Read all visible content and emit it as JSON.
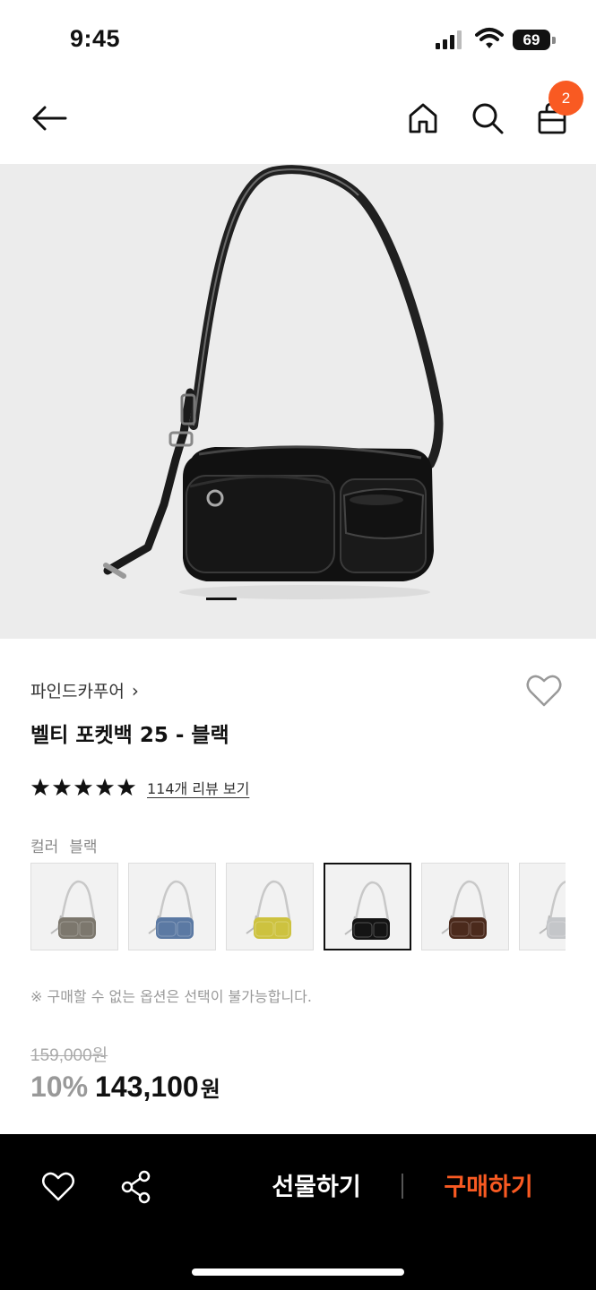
{
  "status_bar": {
    "time": "9:45",
    "battery": "69",
    "icons": [
      "signal-icon",
      "wifi-icon",
      "battery-icon"
    ]
  },
  "top_nav": {
    "icons": [
      "back-arrow-icon",
      "home-icon",
      "search-icon",
      "shopping-bag-icon"
    ],
    "cart_count": "2"
  },
  "hero": {
    "image": "black shoulder bag photo",
    "carousel_indicator": "first"
  },
  "product": {
    "brand": "파인드카푸어",
    "brand_chevron": "›",
    "name": "벨티 포켓백 25 - 블랙",
    "rating_stars": 5,
    "review_link": "114개 리뷰 보기",
    "color_label": "컬러",
    "color_value": "블랙",
    "swatches": [
      {
        "color": "#7c776d",
        "selected": false
      },
      {
        "color": "#5b79a3",
        "selected": false
      },
      {
        "color": "#cdc23f",
        "selected": false
      },
      {
        "color": "#141414",
        "selected": true
      },
      {
        "color": "#4b2a1c",
        "selected": false
      },
      {
        "color": "#c4c6c9",
        "selected": false
      }
    ],
    "notice": "※ 구매할 수 없는 옵션은 선택이 불가능합니다.",
    "original_price": "159,000원",
    "discount": "10%",
    "price": "143,100",
    "price_unit": "원"
  },
  "bottom_bar": {
    "icons": [
      "heart-icon",
      "share-icon"
    ],
    "gift_label": "선물하기",
    "buy_label": "구매하기"
  },
  "colors": {
    "accent": "#f95a22",
    "hero_bg": "#ececec",
    "bottom_bar_bg": "#000000"
  }
}
